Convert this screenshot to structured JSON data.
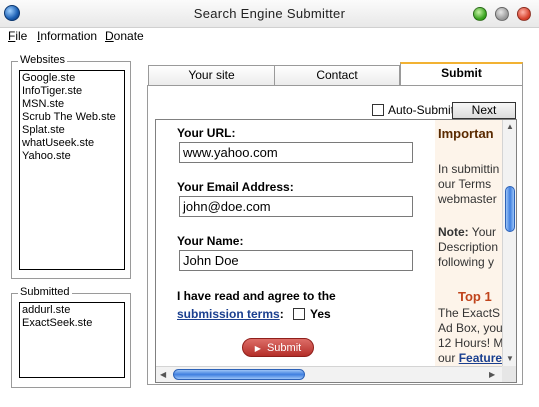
{
  "window": {
    "title": "Search Engine Submitter"
  },
  "menu": {
    "file_prefix": "",
    "file_accel": "F",
    "file_rest": "ile",
    "info_accel": "I",
    "info_rest": "nformation",
    "donate_accel": "D",
    "donate_rest": "onate"
  },
  "websites": {
    "label": "Websites",
    "items": [
      "Google.ste",
      "InfoTiger.ste",
      "MSN.ste",
      "Scrub The Web.ste",
      "Splat.ste",
      "whatUseek.ste",
      "Yahoo.ste"
    ]
  },
  "submitted": {
    "label": "Submitted",
    "items": [
      "addurl.ste",
      "ExactSeek.ste"
    ]
  },
  "tabs": [
    {
      "label": "Your site"
    },
    {
      "label": "Contact"
    },
    {
      "label": "Submit"
    }
  ],
  "toolbar": {
    "auto_submit_label": "Auto-Submit",
    "auto_submit_checked": false,
    "next_label": "Next"
  },
  "form": {
    "url_label": "Your URL:",
    "url_value": "www.yahoo.com",
    "email_label": "Your Email Address:",
    "email_value": "john@doe.com",
    "name_label": "Your Name:",
    "name_value": "John Doe",
    "agree_line1": "I have read and agree to the",
    "terms_link": "submission terms",
    "agree_colon": ":",
    "yes_label": "Yes",
    "yes_checked": false,
    "submit_label": "Submit"
  },
  "side_panel": {
    "heading": "Importan",
    "para1": [
      "In submittin",
      "our Terms",
      "webmaster"
    ],
    "note_bold": "Note:",
    "note_rest": " Your",
    "para2": [
      "Description",
      "following y"
    ],
    "top10": "Top 1",
    "para3": [
      "The ExactS",
      "Ad Box, you",
      "12 Hours! M"
    ],
    "feature_prefix": "our ",
    "feature_link": "Feature"
  }
}
